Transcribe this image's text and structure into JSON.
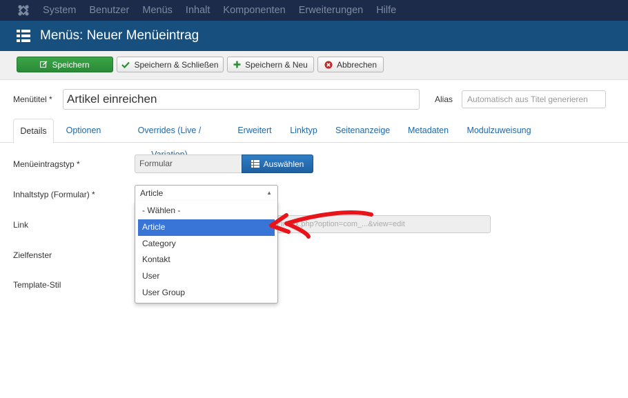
{
  "topnav": {
    "items": [
      "System",
      "Benutzer",
      "Menüs",
      "Inhalt",
      "Komponenten",
      "Erweiterungen",
      "Hilfe"
    ]
  },
  "titlebar": {
    "title": "Menüs: Neuer Menüeintrag"
  },
  "toolbar": {
    "save": "Speichern",
    "save_close": "Speichern & Schließen",
    "save_new": "Speichern & Neu",
    "cancel": "Abbrechen"
  },
  "header": {
    "title_label": "Menütitel *",
    "title_value": "Artikel einreichen",
    "alias_label": "Alias",
    "alias_placeholder": "Automatisch aus Titel generieren"
  },
  "tabs": [
    "Details",
    "Optionen",
    "Overrides (Live / Variation)",
    "Erweitert",
    "Linktyp",
    "Seitenanzeige",
    "Metadaten",
    "Modulzuweisung"
  ],
  "form": {
    "menu_type_label": "Menüeintragstyp *",
    "menu_type_value": "Formular",
    "select_button": "Auswählen",
    "content_type_label": "Inhaltstyp (Formular) *",
    "content_type_value": "Article",
    "link_label": "Link",
    "link_value": "index.php?option=com_...&view=edit",
    "target_label": "Zielfenster",
    "template_label": "Template-Stil"
  },
  "dropdown": {
    "options": [
      "- Wählen -",
      "Article",
      "Category",
      "Kontakt",
      "User",
      "User Group"
    ],
    "highlighted": "Article"
  },
  "colors": {
    "topnav_bg": "#1b2b49",
    "titlebar_bg": "#17507f",
    "save_green": "#2b8a37",
    "primary_blue": "#1e5fa0",
    "highlight": "#3875d7",
    "annotation_red": "#e8141b"
  }
}
